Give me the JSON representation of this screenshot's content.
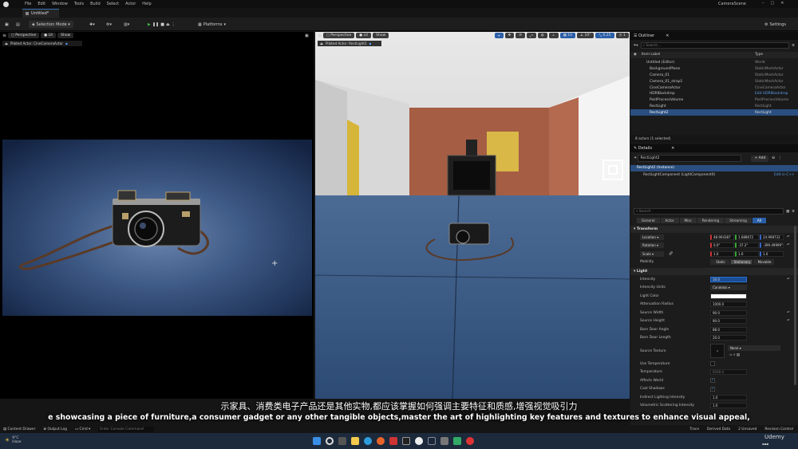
{
  "menubar": {
    "items": [
      "File",
      "Edit",
      "Window",
      "Tools",
      "Build",
      "Select",
      "Actor",
      "Help"
    ],
    "project": "CameraScene"
  },
  "doc_tab": "Untitled*",
  "toolbar": {
    "mode": "Selection Mode",
    "platforms": "Platforms",
    "settings": "Settings"
  },
  "left_viewport": {
    "perspective": "Perspective",
    "lit": "Lit",
    "show": "Show",
    "pilot": "Piloted Actor: CineCameraActor"
  },
  "right_viewport": {
    "perspective": "Perspective",
    "lit": "Lit",
    "show": "Show",
    "pilot": "Piloted Actor: RectLight2",
    "snap_grid": "10",
    "snap_rot": "10°",
    "snap_scale": "0.25",
    "cam_speed": "1"
  },
  "outliner": {
    "title": "Outliner",
    "search_placeholder": "Search...",
    "col_label": "Item Label",
    "col_type": "Type",
    "items": [
      {
        "name": "Untitled (Editor)",
        "type": "World"
      },
      {
        "name": "BackgroundPlane",
        "type": "StaticMeshActor"
      },
      {
        "name": "Camera_01",
        "type": "StaticMeshActor"
      },
      {
        "name": "Camera_01_strap1",
        "type": "StaticMeshActor"
      },
      {
        "name": "CineCameraActor",
        "type": "CineCameraActor"
      },
      {
        "name": "HDRIBackdrop",
        "type": "Edit HDRIBackdrop"
      },
      {
        "name": "PostProcessVolume",
        "type": "PostProcessVolume"
      },
      {
        "name": "RectLight",
        "type": "RectLight"
      },
      {
        "name": "RectLight2",
        "type": "RectLight"
      }
    ],
    "status": "8 actors (1 selected)"
  },
  "details": {
    "title": "Details",
    "actor_name": "RectLight2",
    "add_label": "+ Add",
    "instance_label": "RectLight2 (Instance)",
    "component_label": "RectLightComponent (LightComponent0)",
    "edit_cpp": "Edit in C++",
    "search_placeholder": "Search",
    "tabs": [
      "General",
      "Actor",
      "Misc",
      "Rendering",
      "Streaming",
      "All"
    ],
    "sections": {
      "transform": "Transform",
      "light": "Light"
    },
    "location": {
      "label": "Location",
      "x": "48.904387",
      "y": "1.688672",
      "z": "24.998732"
    },
    "rotation": {
      "label": "Rotation",
      "x": "0.0°",
      "y": "-37.2°",
      "z": "-399.49999°"
    },
    "scale": {
      "label": "Scale",
      "x": "1.0",
      "y": "1.0",
      "z": "1.0"
    },
    "mobility": {
      "label": "Mobility",
      "options": [
        "Static",
        "Stationary",
        "Movable"
      ],
      "active": "Stationary"
    },
    "props": [
      {
        "label": "Intensity",
        "value": "10.0"
      },
      {
        "label": "Intensity Units",
        "value": "Candelas"
      },
      {
        "label": "Light Color",
        "value": ""
      },
      {
        "label": "Attenuation Radius",
        "value": "1000.0"
      },
      {
        "label": "Source Width",
        "value": "90.0"
      },
      {
        "label": "Source Height",
        "value": "90.0"
      },
      {
        "label": "Barn Door Angle",
        "value": "88.0"
      },
      {
        "label": "Barn Door Length",
        "value": "20.0"
      },
      {
        "label": "Source Texture",
        "value": "None"
      },
      {
        "label": "Use Temperature",
        "value": ""
      },
      {
        "label": "Temperature",
        "value": "6500.0"
      },
      {
        "label": "Affects World",
        "value": ""
      },
      {
        "label": "Cast Shadows",
        "value": ""
      },
      {
        "label": "Indirect Lighting Intensity",
        "value": "1.0"
      },
      {
        "label": "Volumetric Scattering Intensity",
        "value": "1.0"
      }
    ]
  },
  "bottom_bar": {
    "content_drawer": "Content Drawer",
    "output_log": "Output Log",
    "cmd": "Cmd",
    "cmd_placeholder": "Enter Console Command",
    "trace": "Trace",
    "derived": "Derived Data",
    "unsaved": "2 Unsaved",
    "revision": "Revision Control"
  },
  "subtitles": {
    "zh": "示家具、消费类电子产品还是其他实物,都应该掌握如何强调主要特征和质感,增强视觉吸引力",
    "en": "e showcasing a piece of furniture,a consumer gadget or any other tangible objects,master the art of highlighting key features and textures to enhance visual appeal,"
  },
  "taskbar": {
    "temp": "9°C",
    "weather": "Haze",
    "watermark": "Udemy"
  },
  "colors": {
    "selection": "#2a4e7f",
    "accent": "#3a6fb5",
    "play": "#3fb34f",
    "floor_blue": "#3c5a86"
  }
}
